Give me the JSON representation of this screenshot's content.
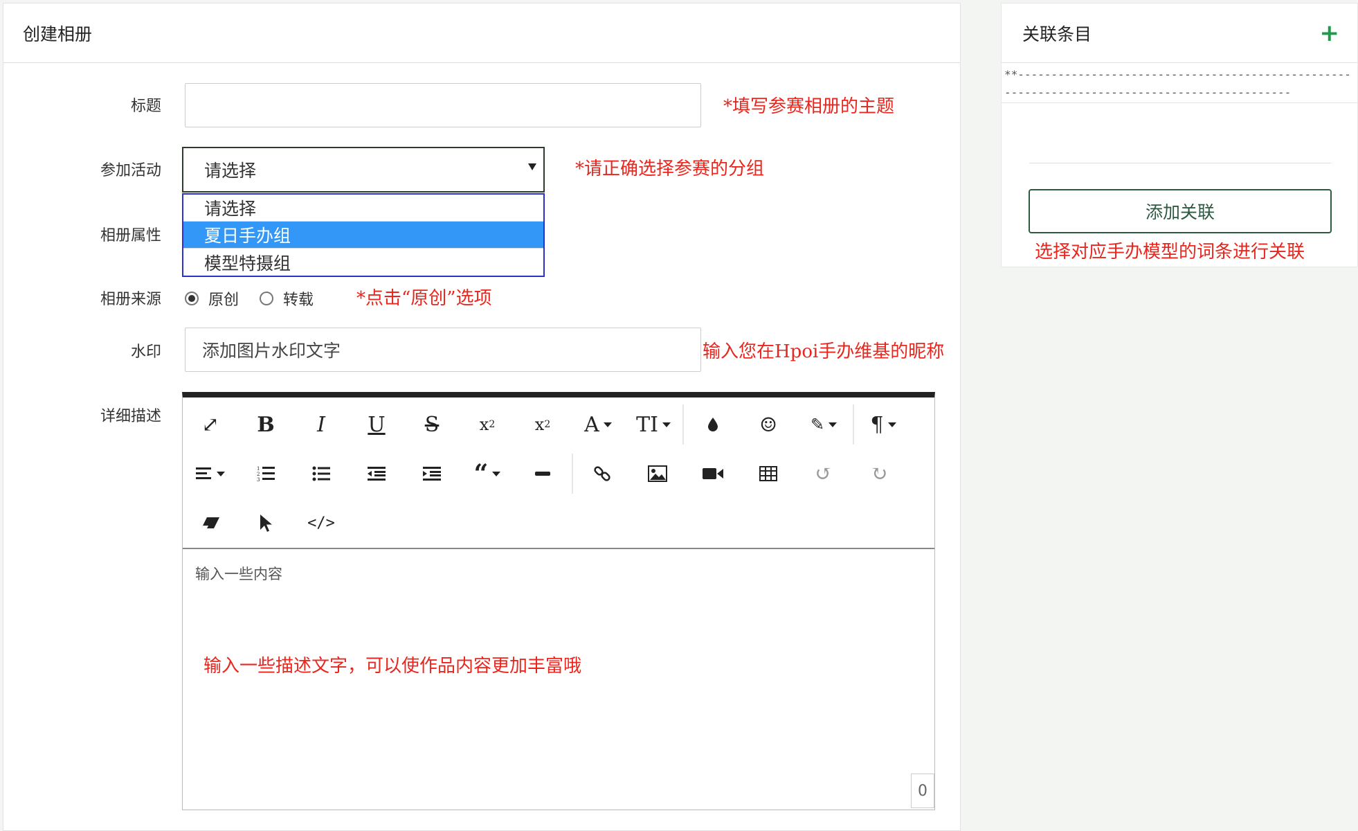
{
  "main": {
    "title": "创建相册",
    "labels": {
      "title": "标题",
      "activity": "参加活动",
      "property": "相册属性",
      "source": "相册来源",
      "watermark": "水印",
      "description": "详细描述"
    },
    "title_input": {
      "value": "",
      "hint": "*填写参赛相册的主题"
    },
    "activity_select": {
      "value": "请选择",
      "options": [
        "请选择",
        "夏日手办组",
        "模型特摄组"
      ],
      "highlighted": "夏日手办组",
      "hint": "*请正确选择参赛的分组"
    },
    "source_radio": {
      "options": [
        "原创",
        "转载"
      ],
      "selected": "原创",
      "hint": "*点击“原创”选项"
    },
    "watermark_input": {
      "value": "添加图片水印文字",
      "hint": "输入您在Hpoi手办维基的昵称"
    },
    "editor": {
      "placeholder": "输入一些内容",
      "hint": "输入一些描述文字，可以使作品内容更加丰富哦",
      "char_count": "0",
      "toolbar_icons": [
        "fullscreen-icon",
        "bold-icon",
        "italic-icon",
        "underline-icon",
        "strikethrough-icon",
        "subscript-icon",
        "superscript-icon",
        "font-color-icon",
        "font-size-icon",
        "droplet-icon",
        "emoji-icon",
        "magic-wand-icon",
        "paragraph-icon",
        "align-icon",
        "ordered-list-icon",
        "unordered-list-icon",
        "outdent-icon",
        "indent-icon",
        "quote-icon",
        "horizontal-rule-icon",
        "link-icon",
        "image-icon",
        "video-icon",
        "table-icon",
        "undo-icon",
        "redo-icon",
        "eraser-icon",
        "cursor-icon",
        "code-icon"
      ]
    }
  },
  "sidebar": {
    "title": "关联条目",
    "dash_text": "**---------------------------------------------------------------------------------------------",
    "button_label": "添加关联",
    "hint": "选择对应手办模型的词条进行关联"
  },
  "colors": {
    "hint_red": "#e8261d",
    "select_highlight": "#3397f8",
    "accent_green": "#1e9a4c"
  }
}
